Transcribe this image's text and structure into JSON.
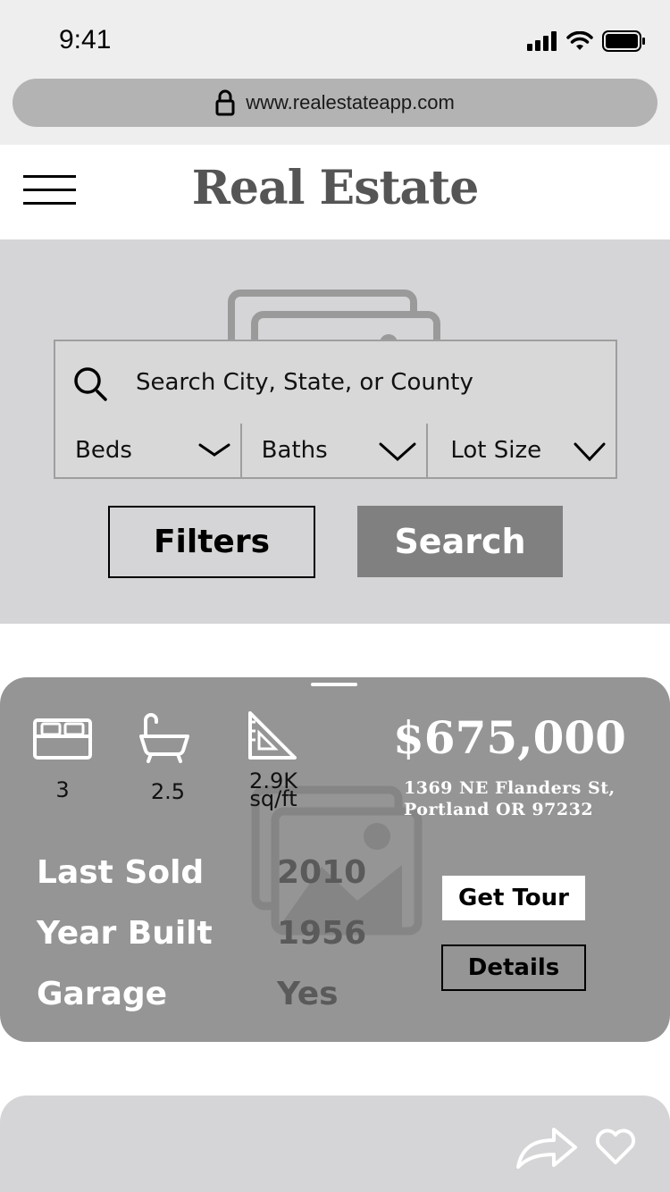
{
  "status_bar": {
    "time": "9:41"
  },
  "browser": {
    "url": "www.realestateapp.com"
  },
  "header": {
    "title": "Real Estate",
    "menu_icon": "hamburger-menu-icon"
  },
  "search": {
    "placeholder": "Search City, State, or County",
    "dropdowns": [
      {
        "label": "Beds"
      },
      {
        "label": "Baths"
      },
      {
        "label": "Lot Size"
      }
    ],
    "filters_label": "Filters",
    "search_label": "Search"
  },
  "listing": {
    "beds": "3",
    "baths": "2.5",
    "area_line1": "2.9K",
    "area_line2": "sq/ft",
    "price": "$675,000",
    "address_line1": "1369 NE Flanders St,",
    "address_line2": "Portland OR 97232",
    "stats": [
      {
        "label": "Last Sold",
        "value": "2010"
      },
      {
        "label": "Year Built",
        "value": "1956"
      },
      {
        "label": "Garage",
        "value": "Yes"
      }
    ],
    "tour_label": "Get Tour",
    "details_label": "Details"
  },
  "colors": {
    "status_bg": "#eeeeee",
    "hero_bg": "#d5d5d7",
    "card_bg": "#959595",
    "search_button": "#808080",
    "title": "#555555"
  }
}
